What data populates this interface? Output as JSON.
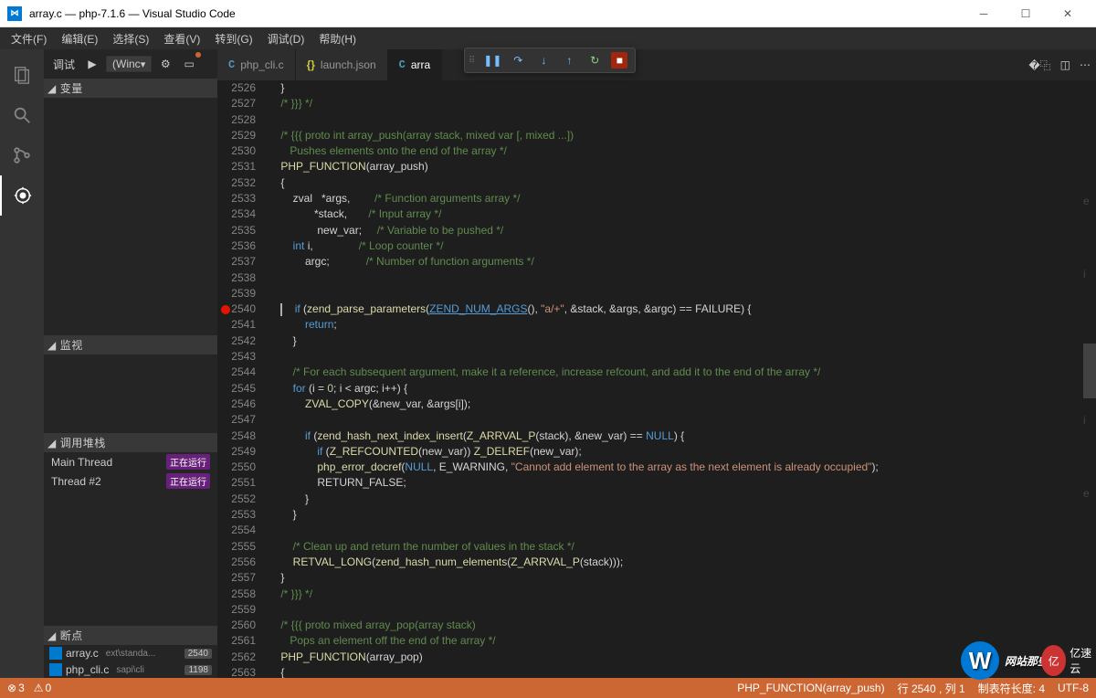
{
  "window": {
    "title": "array.c — php-7.1.6 — Visual Studio Code"
  },
  "menu": {
    "items": [
      "文件(F)",
      "编辑(E)",
      "选择(S)",
      "查看(V)",
      "转到(G)",
      "调试(D)",
      "帮助(H)"
    ]
  },
  "debug_header": {
    "label": "调试",
    "config": "(Winc"
  },
  "panels": {
    "vars": "变量",
    "watch": "监视",
    "callstack": "调用堆栈",
    "breakpoints": "断点"
  },
  "threads": [
    {
      "name": "Main Thread",
      "status": "正在运行"
    },
    {
      "name": "Thread #2",
      "status": "正在运行"
    }
  ],
  "breakpoints": [
    {
      "file": "array.c",
      "path": "ext\\standa...",
      "line": "2540"
    },
    {
      "file": "php_cli.c",
      "path": "sapi\\cli",
      "line": "1198"
    }
  ],
  "tabs": [
    {
      "icon": "C",
      "label": "php_cli.c",
      "active": false
    },
    {
      "icon": "{}",
      "label": "launch.json",
      "active": false
    },
    {
      "icon": "C",
      "label": "arra",
      "active": true
    }
  ],
  "lines": {
    "start": 2526,
    "end": 2563,
    "bp": 2540
  },
  "code": [
    {
      "n": 2526,
      "t": "    }"
    },
    {
      "n": 2527,
      "t": "    /* }}} */",
      "c": "cm"
    },
    {
      "n": 2528,
      "t": ""
    },
    {
      "n": 2529,
      "h": "    <span class='cm'>/* {{{ proto int array_push(array stack, mixed var [, mixed ...])</span>"
    },
    {
      "n": 2530,
      "h": "    <span class='cm'>   Pushes elements onto the end of the array */</span>"
    },
    {
      "n": 2531,
      "h": "    <span class='fn'>PHP_FUNCTION</span>(array_push)"
    },
    {
      "n": 2532,
      "t": "    {"
    },
    {
      "n": 2533,
      "h": "        zval   *args,        <span class='cm'>/* Function arguments array */</span>"
    },
    {
      "n": 2534,
      "h": "               *stack,       <span class='cm'>/* Input array */</span>"
    },
    {
      "n": 2535,
      "h": "                new_var;     <span class='cm'>/* Variable to be pushed */</span>"
    },
    {
      "n": 2536,
      "h": "        <span class='kw'>int</span> i,               <span class='cm'>/* Loop counter */</span>"
    },
    {
      "n": 2537,
      "h": "            argc;            <span class='cm'>/* Number of function arguments */</span>"
    },
    {
      "n": 2538,
      "t": ""
    },
    {
      "n": 2539,
      "t": ""
    },
    {
      "n": 2540,
      "h": "    <span class='cur'></span>    <span class='kw'>if</span> (<span class='fn'>zend_parse_parameters</span>(<span class='lk'>ZEND_NUM_ARGS</span>(), <span class='st'>\"a/+\"</span>, &amp;stack, &amp;args, &amp;argc) == FAILURE) {"
    },
    {
      "n": 2541,
      "h": "            <span class='kw'>return</span>;"
    },
    {
      "n": 2542,
      "t": "        }"
    },
    {
      "n": 2543,
      "t": ""
    },
    {
      "n": 2544,
      "h": "        <span class='cm'>/* For each subsequent argument, make it a reference, increase refcount, and add it to the end of the array */</span>"
    },
    {
      "n": 2545,
      "h": "        <span class='kw'>for</span> (i = <span class='nm'>0</span>; i &lt; argc; i++) {"
    },
    {
      "n": 2546,
      "h": "            <span class='fn'>ZVAL_COPY</span>(&amp;new_var, &amp;args[i]);"
    },
    {
      "n": 2547,
      "t": ""
    },
    {
      "n": 2548,
      "h": "            <span class='kw'>if</span> (<span class='fn'>zend_hash_next_index_insert</span>(<span class='fn'>Z_ARRVAL_P</span>(stack), &amp;new_var) == <span class='kw'>NULL</span>) {"
    },
    {
      "n": 2549,
      "h": "                <span class='kw'>if</span> (<span class='fn'>Z_REFCOUNTED</span>(new_var)) <span class='fn'>Z_DELREF</span>(new_var);"
    },
    {
      "n": 2550,
      "h": "                <span class='fn'>php_error_docref</span>(<span class='kw'>NULL</span>, E_WARNING, <span class='st'>\"Cannot add element to the array as the next element is already occupied\"</span>);"
    },
    {
      "n": 2551,
      "h": "                RETURN_FALSE;"
    },
    {
      "n": 2552,
      "t": "            }"
    },
    {
      "n": 2553,
      "t": "        }"
    },
    {
      "n": 2554,
      "t": ""
    },
    {
      "n": 2555,
      "h": "        <span class='cm'>/* Clean up and return the number of values in the stack */</span>"
    },
    {
      "n": 2556,
      "h": "        <span class='fn'>RETVAL_LONG</span>(<span class='fn'>zend_hash_num_elements</span>(<span class='fn'>Z_ARRVAL_P</span>(stack)));"
    },
    {
      "n": 2557,
      "t": "    }"
    },
    {
      "n": 2558,
      "h": "    <span class='cm'>/* }}} */</span>"
    },
    {
      "n": 2559,
      "t": ""
    },
    {
      "n": 2560,
      "h": "    <span class='cm'>/* {{{ proto mixed array_pop(array stack)</span>"
    },
    {
      "n": 2561,
      "h": "    <span class='cm'>   Pops an element off the end of the array */</span>"
    },
    {
      "n": 2562,
      "h": "    <span class='fn'>PHP_FUNCTION</span>(array_pop)"
    },
    {
      "n": 2563,
      "t": "    {"
    }
  ],
  "status": {
    "errors": "3",
    "warnings": "0",
    "func": "PHP_FUNCTION(array_push)",
    "pos": "行 2540 , 列 1",
    "spaces": "制表符长度: 4",
    "enc": "UTF-8"
  },
  "wm": {
    "text": "网站那些事"
  }
}
